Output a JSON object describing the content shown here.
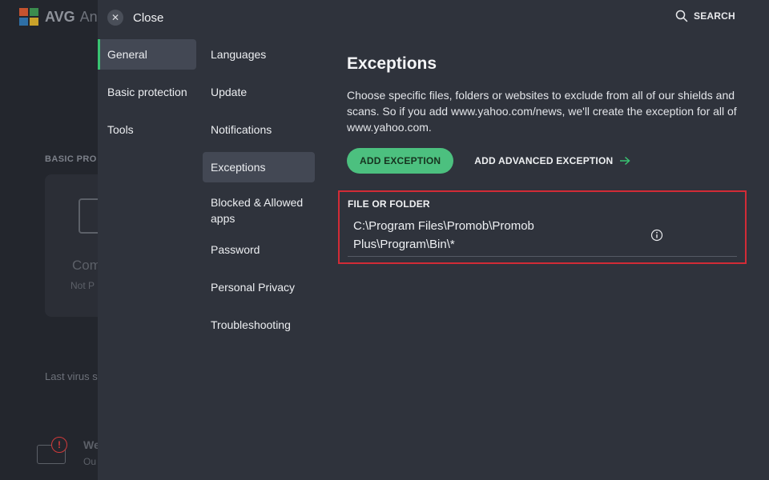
{
  "background": {
    "logo_text": "AVG",
    "logo_sub": "An",
    "section_label": "BASIC PRO",
    "card_title": "Com",
    "card_sub": "Not P",
    "last_scan": "Last virus s",
    "warn_title": "We",
    "warn_sub": "Ou"
  },
  "header": {
    "close_label": "Close",
    "search_label": "SEARCH"
  },
  "nav_primary": [
    {
      "label": "General",
      "active": true
    },
    {
      "label": "Basic protection",
      "active": false
    },
    {
      "label": "Tools",
      "active": false
    }
  ],
  "nav_secondary": [
    {
      "label": "Languages",
      "active": false
    },
    {
      "label": "Update",
      "active": false
    },
    {
      "label": "Notifications",
      "active": false
    },
    {
      "label": "Exceptions",
      "active": true
    },
    {
      "label": "Blocked & Allowed apps",
      "active": false
    },
    {
      "label": "Password",
      "active": false
    },
    {
      "label": "Personal Privacy",
      "active": false
    },
    {
      "label": "Troubleshooting",
      "active": false
    }
  ],
  "content": {
    "title": "Exceptions",
    "description": "Choose specific files, folders or websites to exclude from all of our shields and scans. So if you add www.yahoo.com/news, we'll create the exception for all of www.yahoo.com.",
    "add_exception_label": "ADD EXCEPTION",
    "add_advanced_label": "ADD ADVANCED EXCEPTION",
    "exception": {
      "header": "FILE OR FOLDER",
      "path": "C:\\Program Files\\Promob\\Promob Plus\\Program\\Bin\\*"
    }
  },
  "colors": {
    "accent_green": "#4cc07f",
    "active_bar": "#39c472",
    "highlight_red": "#d22b36"
  },
  "icons": [
    "close-icon",
    "search-icon",
    "arrow-right-icon",
    "info-icon",
    "avg-logo-icon",
    "warning-icon"
  ]
}
